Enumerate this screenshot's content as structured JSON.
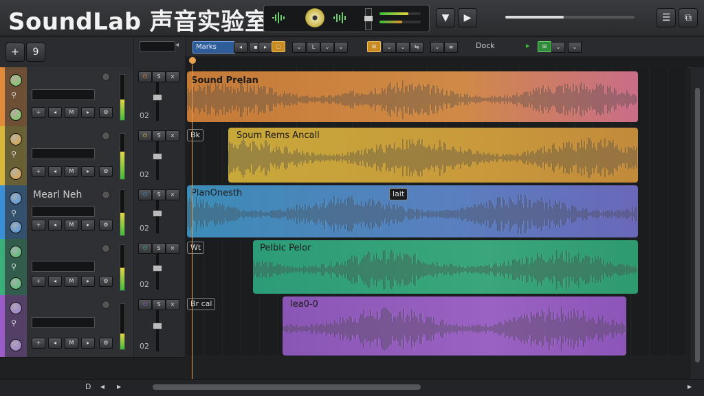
{
  "app": {
    "title": "SoundLab 声音实验室"
  },
  "header": {
    "panel_icon_left": "waveform-icon",
    "panel_icon_right": "waveform-icon"
  },
  "left_top": {
    "add_label": "+",
    "track_count": "9"
  },
  "toolbar": {
    "mode_label": "Marks",
    "dock_label": "Dock"
  },
  "tracks": [
    {
      "name": "",
      "color": "#e08a3a",
      "knob_color": "#6fcf5a",
      "clip_name": "Sound Prelan",
      "tag": "",
      "mix_label": "02",
      "vu": 0.45
    },
    {
      "name": "",
      "color": "#d8b83a",
      "knob_color": "#e0a040",
      "clip_name": "Soum Rems Ancall",
      "tag": "Bk",
      "mix_label": "02",
      "vu": 0.6
    },
    {
      "name": "Mearl Neh",
      "color": "#3b8fd6",
      "knob_color": "#4a90e0",
      "clip_name": "PlanOnesth",
      "tag": "lait",
      "mix_label": "02",
      "vu": 0.5
    },
    {
      "name": "",
      "color": "#39b07a",
      "knob_color": "#4ec06a",
      "clip_name": "Pelbic Pelor",
      "tag": "Wt",
      "mix_label": "02",
      "vu": 0.5
    },
    {
      "name": "",
      "color": "#9a5cc8",
      "knob_color": "#9c7ad0",
      "clip_name": "lea0-0",
      "tag": "Br cal",
      "mix_label": "02",
      "vu": 0.35
    }
  ],
  "colors": {
    "accent": "#e8a050",
    "meter_green": "#3bbf3b",
    "meter_yellow": "#e6d640"
  }
}
